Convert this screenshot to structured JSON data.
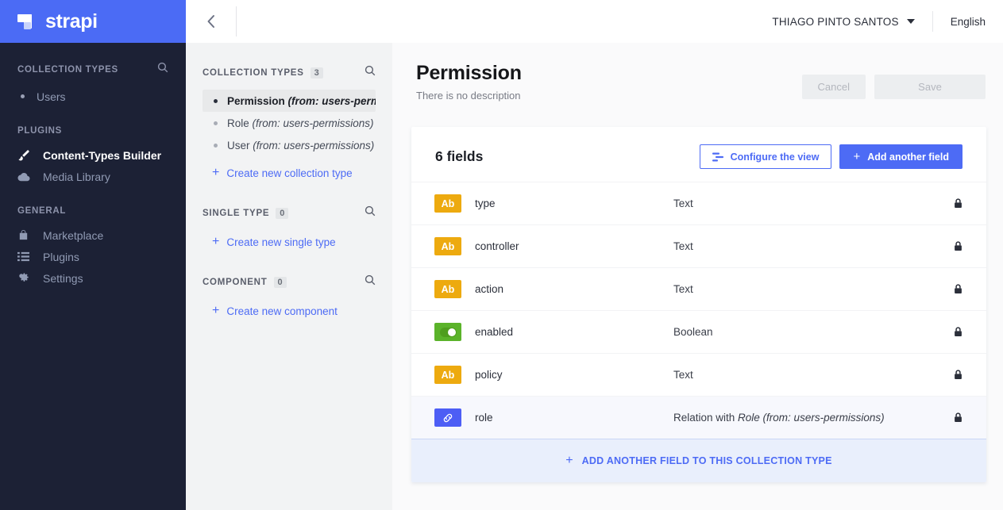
{
  "brand": {
    "name": "strapi",
    "logo_color": "#4b6bf5"
  },
  "sidebar": {
    "sections": [
      {
        "label": "COLLECTION TYPES",
        "search_icon": "search-icon",
        "items": [
          {
            "label": "Users",
            "icon": "bullet-icon",
            "active": false
          }
        ]
      },
      {
        "label": "PLUGINS",
        "items": [
          {
            "label": "Content-Types Builder",
            "icon": "brush-icon",
            "active": true
          },
          {
            "label": "Media Library",
            "icon": "cloud-icon",
            "active": false
          }
        ]
      },
      {
        "label": "GENERAL",
        "items": [
          {
            "label": "Marketplace",
            "icon": "shopping-bag-icon",
            "active": false
          },
          {
            "label": "Plugins",
            "icon": "list-icon",
            "active": false
          },
          {
            "label": "Settings",
            "icon": "gear-icon",
            "active": false
          }
        ]
      }
    ]
  },
  "content_types_panel": {
    "collapse_icon": "chevron-left-icon",
    "collection_types": {
      "label": "COLLECTION TYPES",
      "count": "3",
      "search_icon": "search-icon",
      "items": [
        {
          "name": "Permission",
          "source": "(from: users-permis...",
          "selected": true
        },
        {
          "name": "Role",
          "source": "(from: users-permissions)",
          "selected": false
        },
        {
          "name": "User",
          "source": "(from: users-permissions)",
          "selected": false
        }
      ],
      "create_label": "Create new collection type"
    },
    "single_type": {
      "label": "SINGLE TYPE",
      "count": "0",
      "search_icon": "search-icon",
      "create_label": "Create new single type"
    },
    "component": {
      "label": "COMPONENT",
      "count": "0",
      "search_icon": "search-icon",
      "create_label": "Create new component"
    }
  },
  "topbar": {
    "user_name": "THIAGO PINTO SANTOS",
    "caret_icon": "chevron-down-icon",
    "language": "English"
  },
  "page": {
    "title": "Permission",
    "description": "There is no description",
    "cancel_label": "Cancel",
    "save_label": "Save"
  },
  "fields_card": {
    "title": "6 fields",
    "configure_label": "Configure the view",
    "configure_icon": "layout-icon",
    "add_field_label": "Add another field",
    "add_field_icon": "plus-icon",
    "lock_icon": "lock-icon",
    "rows": [
      {
        "name": "type",
        "type": "Text",
        "type_suffix": "",
        "icon": "text-type-icon",
        "icon_kind": "text",
        "icon_label": "Ab",
        "locked": true,
        "highlight": false
      },
      {
        "name": "controller",
        "type": "Text",
        "type_suffix": "",
        "icon": "text-type-icon",
        "icon_kind": "text",
        "icon_label": "Ab",
        "locked": true,
        "highlight": false
      },
      {
        "name": "action",
        "type": "Text",
        "type_suffix": "",
        "icon": "text-type-icon",
        "icon_kind": "text",
        "icon_label": "Ab",
        "locked": true,
        "highlight": false
      },
      {
        "name": "enabled",
        "type": "Boolean",
        "type_suffix": "",
        "icon": "boolean-type-icon",
        "icon_kind": "bool",
        "icon_label": "",
        "locked": true,
        "highlight": false
      },
      {
        "name": "policy",
        "type": "Text",
        "type_suffix": "",
        "icon": "text-type-icon",
        "icon_kind": "text",
        "icon_label": "Ab",
        "locked": true,
        "highlight": false
      },
      {
        "name": "role",
        "type": "Relation with ",
        "type_suffix": "Role (from: users-permissions)",
        "icon": "relation-type-icon",
        "icon_kind": "relation",
        "icon_label": "",
        "locked": true,
        "highlight": true
      }
    ],
    "footer_label": "ADD ANOTHER FIELD TO THIS COLLECTION TYPE",
    "footer_icon": "plus-icon"
  },
  "colors": {
    "brand_blue": "#4d6bf5",
    "sidebar_dark": "#1c2135",
    "text_type": "#edaa0f",
    "bool_type": "#5bb32a",
    "relation_type": "#4d5ef5"
  }
}
